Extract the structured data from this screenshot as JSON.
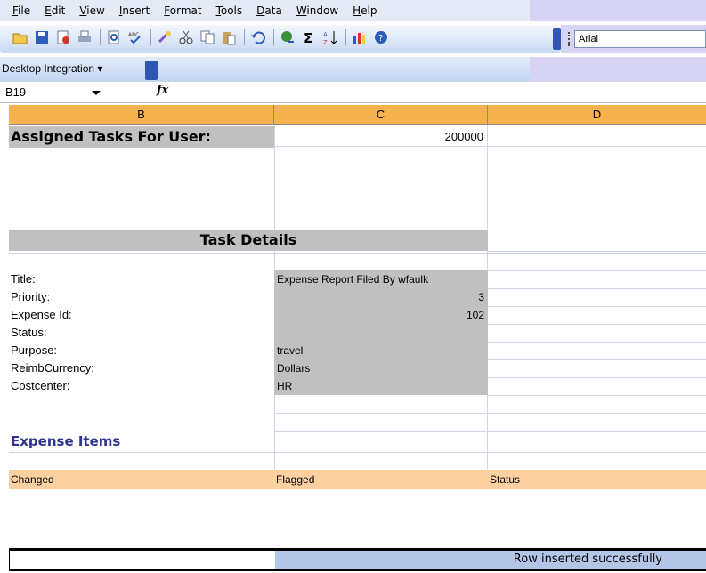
{
  "menubar": {
    "items": [
      "File",
      "Edit",
      "View",
      "Insert",
      "Format",
      "Tools",
      "Data",
      "Window",
      "Help"
    ]
  },
  "toolbar": {
    "icons": [
      "new-icon",
      "open-icon",
      "save-icon",
      "permission-icon",
      "print-icon",
      "print-preview-icon",
      "spelling-icon",
      "research-icon",
      "cut-icon",
      "copy-icon",
      "paste-icon",
      "undo-icon",
      "hyperlink-icon",
      "autosum-icon",
      "sort-ascending-icon",
      "chart-wizard-icon",
      "help-icon"
    ],
    "font_name": "Arial"
  },
  "desktop_integration": {
    "label": "Desktop Integration"
  },
  "formula_bar": {
    "name_box": "B19",
    "fx_label": "fx"
  },
  "columns": [
    "B",
    "C",
    "D"
  ],
  "sheet": {
    "assigned_label": "Assigned Tasks For User:",
    "assigned_value": "200000",
    "task_details_header": "Task Details",
    "fields": [
      {
        "label": "Title:",
        "value": "Expense Report Filed By wfaulk",
        "numeric": false
      },
      {
        "label": "Priority:",
        "value": "3",
        "numeric": true
      },
      {
        "label": "Expense Id:",
        "value": "102",
        "numeric": true
      },
      {
        "label": "Status:",
        "value": "",
        "numeric": false
      },
      {
        "label": "Purpose:",
        "value": "travel",
        "numeric": false
      },
      {
        "label": "ReimbCurrency:",
        "value": "Dollars",
        "numeric": false
      },
      {
        "label": "Costcenter:",
        "value": "HR",
        "numeric": false
      }
    ],
    "expense_items_header": "Expense Items",
    "expense_columns": [
      "Changed",
      "Flagged",
      "Status"
    ]
  },
  "status": {
    "message": "Row inserted successfully"
  },
  "colors": {
    "column_header": "#f5b24f",
    "gray_fill": "#c0c0c0",
    "peach_fill": "#fcd0a1",
    "expense_title": "#2e3392",
    "status_fill": "#b4c6e7"
  }
}
